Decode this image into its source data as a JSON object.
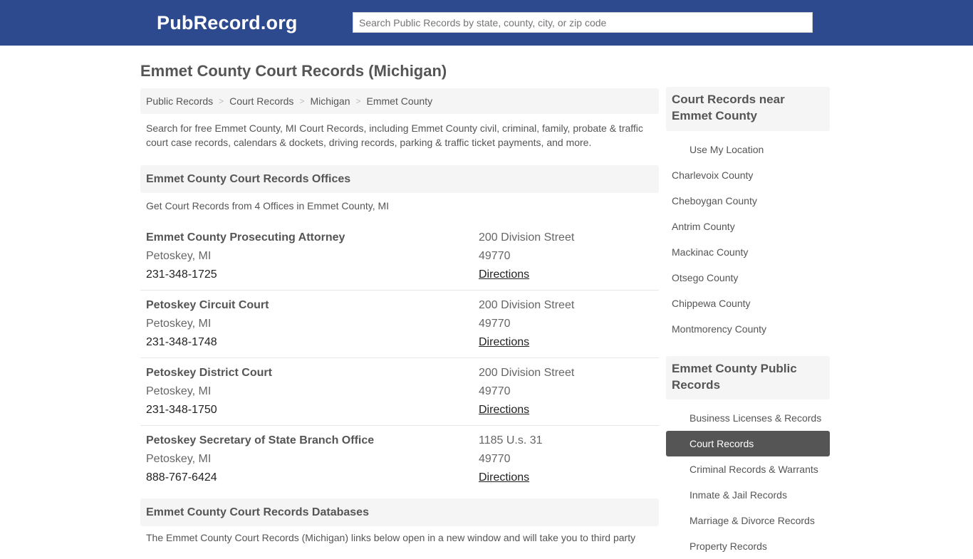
{
  "header": {
    "logo": "PubRecord.org",
    "search_placeholder": "Search Public Records by state, county, city, or zip code",
    "brand_color": "#2e4a8f"
  },
  "page_title": "Emmet County Court Records (Michigan)",
  "breadcrumb": [
    {
      "label": "Public Records"
    },
    {
      "label": "Court Records"
    },
    {
      "label": "Michigan"
    },
    {
      "label": "Emmet County"
    }
  ],
  "intro": "Search for free Emmet County, MI Court Records, including Emmet County civil, criminal, family, probate & traffic court case records, calendars & dockets, driving records, parking & traffic ticket payments, and more.",
  "offices_section": {
    "title": "Emmet County Court Records Offices",
    "subtitle": "Get Court Records from 4 Offices in Emmet County, MI",
    "offices": [
      {
        "name": "Emmet County Prosecuting Attorney",
        "city": "Petoskey, MI",
        "phone": "231-348-1725",
        "address": "200 Division Street",
        "zip": "49770",
        "directions": "Directions"
      },
      {
        "name": "Petoskey Circuit Court",
        "city": "Petoskey, MI",
        "phone": "231-348-1748",
        "address": "200 Division Street",
        "zip": "49770",
        "directions": "Directions"
      },
      {
        "name": "Petoskey District Court",
        "city": "Petoskey, MI",
        "phone": "231-348-1750",
        "address": "200 Division Street",
        "zip": "49770",
        "directions": "Directions"
      },
      {
        "name": "Petoskey Secretary of State Branch Office",
        "city": "Petoskey, MI",
        "phone": "888-767-6424",
        "address": "1185 U.s. 31",
        "zip": "49770",
        "directions": "Directions"
      }
    ]
  },
  "databases_section": {
    "title": "Emmet County Court Records Databases",
    "text": "The Emmet County Court Records (Michigan) links below open in a new window and will take you to third party"
  },
  "sidebar": {
    "nearby": {
      "title": "Court Records near Emmet County",
      "use_location": "Use My Location",
      "items": [
        "Charlevoix County",
        "Cheboygan County",
        "Antrim County",
        "Mackinac County",
        "Otsego County",
        "Chippewa County",
        "Montmorency County"
      ]
    },
    "public_records": {
      "title": "Emmet County Public Records",
      "items": [
        {
          "label": "Business Licenses & Records",
          "active": false
        },
        {
          "label": "Court Records",
          "active": true
        },
        {
          "label": "Criminal Records & Warrants",
          "active": false
        },
        {
          "label": "Inmate & Jail Records",
          "active": false
        },
        {
          "label": "Marriage & Divorce Records",
          "active": false
        },
        {
          "label": "Property Records",
          "active": false
        }
      ]
    }
  }
}
